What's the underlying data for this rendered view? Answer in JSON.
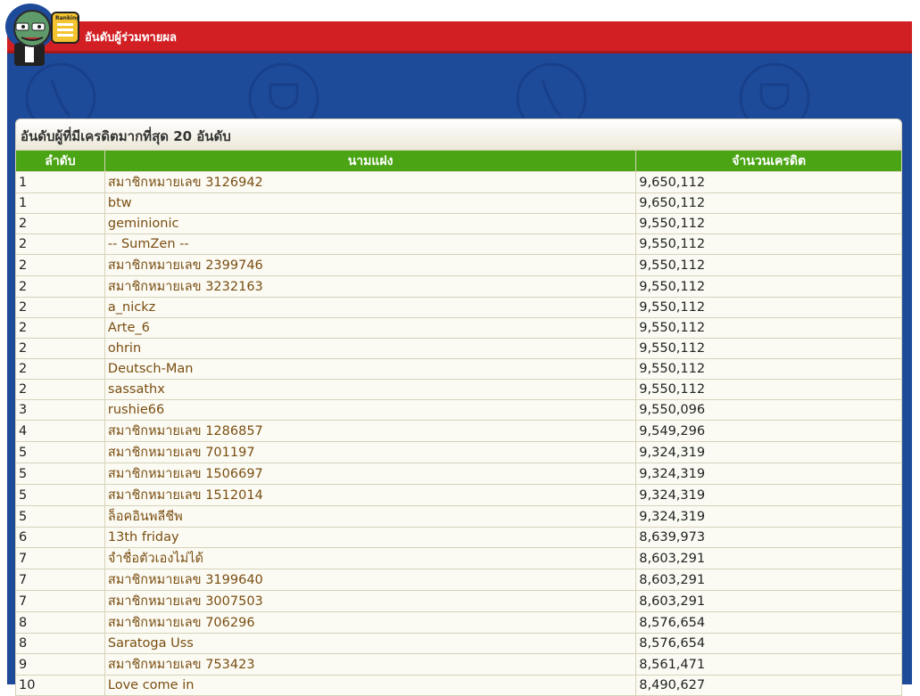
{
  "header": {
    "title": "อันดับผู้ร่วมทายผล",
    "badge": "Ranking"
  },
  "colors": {
    "red_bar": "#d21f24",
    "blue_panel": "#1e4a9a",
    "table_header": "#4aa414",
    "name_text": "#7a4d10"
  },
  "ranking": {
    "title": "อันดับผู้ที่มีเครดิตมากที่สุด 20 อันดับ",
    "columns": [
      "ลำดับ",
      "นามแฝง",
      "จำนวนเครดิต"
    ],
    "rows": [
      {
        "rank": "1",
        "name": "สมาชิกหมายเลข 3126942",
        "credits": "9,650,112"
      },
      {
        "rank": "1",
        "name": "btw",
        "credits": "9,650,112"
      },
      {
        "rank": "2",
        "name": "geminionic",
        "credits": "9,550,112"
      },
      {
        "rank": "2",
        "name": "-- SumZen --",
        "credits": "9,550,112"
      },
      {
        "rank": "2",
        "name": "สมาชิกหมายเลข 2399746",
        "credits": "9,550,112"
      },
      {
        "rank": "2",
        "name": "สมาชิกหมายเลข 3232163",
        "credits": "9,550,112"
      },
      {
        "rank": "2",
        "name": "a_nickz",
        "credits": "9,550,112"
      },
      {
        "rank": "2",
        "name": "Arte_6",
        "credits": "9,550,112"
      },
      {
        "rank": "2",
        "name": "ohrin",
        "credits": "9,550,112"
      },
      {
        "rank": "2",
        "name": "Deutsch-Man",
        "credits": "9,550,112"
      },
      {
        "rank": "2",
        "name": "sassathx",
        "credits": "9,550,112"
      },
      {
        "rank": "3",
        "name": "rushie66",
        "credits": "9,550,096"
      },
      {
        "rank": "4",
        "name": "สมาชิกหมายเลข 1286857",
        "credits": "9,549,296"
      },
      {
        "rank": "5",
        "name": "สมาชิกหมายเลข 701197",
        "credits": "9,324,319"
      },
      {
        "rank": "5",
        "name": "สมาชิกหมายเลข 1506697",
        "credits": "9,324,319"
      },
      {
        "rank": "5",
        "name": "สมาชิกหมายเลข 1512014",
        "credits": "9,324,319"
      },
      {
        "rank": "5",
        "name": "ล็อคอินพลีชีพ",
        "credits": "9,324,319"
      },
      {
        "rank": "6",
        "name": "13th friday",
        "credits": "8,639,973"
      },
      {
        "rank": "7",
        "name": "จำชื่อตัวเองไม่ได้",
        "credits": "8,603,291"
      },
      {
        "rank": "7",
        "name": "สมาชิกหมายเลข 3199640",
        "credits": "8,603,291"
      },
      {
        "rank": "7",
        "name": "สมาชิกหมายเลข 3007503",
        "credits": "8,603,291"
      },
      {
        "rank": "8",
        "name": "สมาชิกหมายเลข 706296",
        "credits": "8,576,654"
      },
      {
        "rank": "8",
        "name": "Saratoga Uss",
        "credits": "8,576,654"
      },
      {
        "rank": "9",
        "name": "สมาชิกหมายเลข 753423",
        "credits": "8,561,471"
      },
      {
        "rank": "10",
        "name": "Love come in",
        "credits": "8,490,627"
      }
    ]
  }
}
